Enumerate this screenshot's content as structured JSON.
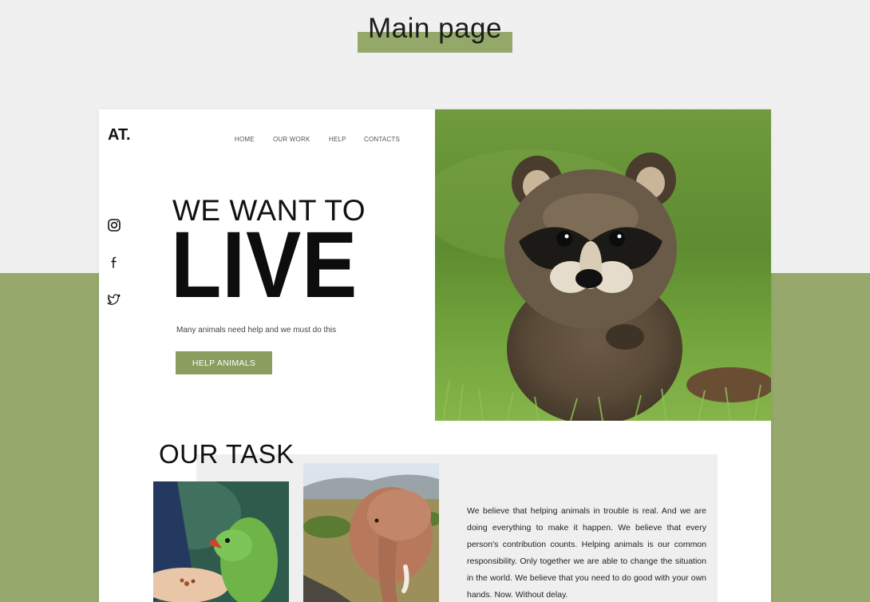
{
  "presentation": {
    "title": "Main page"
  },
  "site": {
    "logo": "AT.",
    "nav": [
      "HOME",
      "OUR WORK",
      "HELP",
      "CONTACTS"
    ],
    "social": [
      "instagram-icon",
      "facebook-icon",
      "twitter-icon"
    ],
    "hero": {
      "line1": "WE WANT TO",
      "line2": "LIVE",
      "description": "Many animals need help and we must do this",
      "cta": "HELP ANIMALS"
    },
    "task": {
      "title": "OUR TASK",
      "text": "We believe that helping animals in trouble is real. And we are doing everything to make it happen. We believe that every person's contribution counts. Helping animals is our common responsibility. Only together we are able to change the situation in the world. We believe that you need to do good with your own hands. Now. Without delay."
    }
  },
  "colors": {
    "accent": "#8a9e5f",
    "band": "#96a86b",
    "background": "#f0f0f0"
  }
}
